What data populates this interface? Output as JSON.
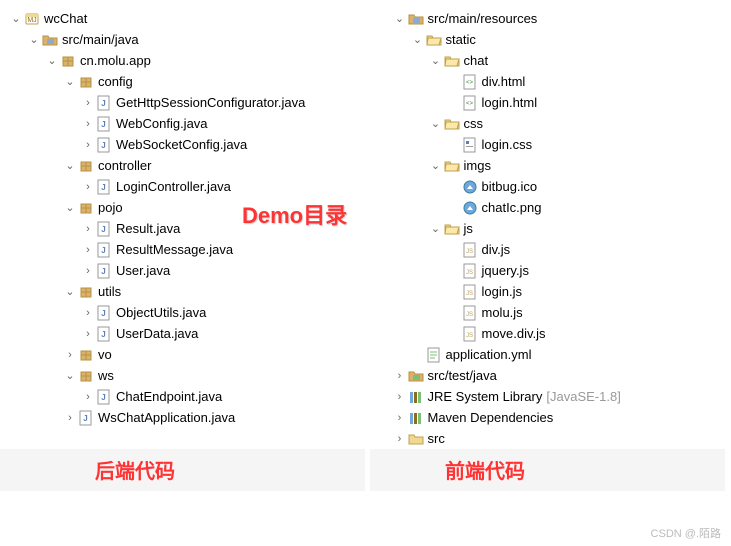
{
  "annotations": {
    "demo": "Demo目录",
    "backend": "后端代码",
    "frontend": "前端代码",
    "watermark": "CSDN @.陌路"
  },
  "left": [
    {
      "d": 0,
      "t": "v",
      "i": "project",
      "l": "wcChat"
    },
    {
      "d": 1,
      "t": "v",
      "i": "src-folder",
      "l": "src/main/java"
    },
    {
      "d": 2,
      "t": "v",
      "i": "package",
      "l": "cn.molu.app"
    },
    {
      "d": 3,
      "t": "v",
      "i": "package",
      "l": "config"
    },
    {
      "d": 4,
      "t": ">",
      "i": "java",
      "l": "GetHttpSessionConfigurator.java"
    },
    {
      "d": 4,
      "t": ">",
      "i": "java",
      "l": "WebConfig.java"
    },
    {
      "d": 4,
      "t": ">",
      "i": "java",
      "l": "WebSocketConfig.java"
    },
    {
      "d": 3,
      "t": "v",
      "i": "package",
      "l": "controller"
    },
    {
      "d": 4,
      "t": ">",
      "i": "java",
      "l": "LoginController.java"
    },
    {
      "d": 3,
      "t": "v",
      "i": "package",
      "l": "pojo"
    },
    {
      "d": 4,
      "t": ">",
      "i": "java",
      "l": "Result.java"
    },
    {
      "d": 4,
      "t": ">",
      "i": "java",
      "l": "ResultMessage.java"
    },
    {
      "d": 4,
      "t": ">",
      "i": "java",
      "l": "User.java"
    },
    {
      "d": 3,
      "t": "v",
      "i": "package",
      "l": "utils"
    },
    {
      "d": 4,
      "t": ">",
      "i": "java",
      "l": "ObjectUtils.java"
    },
    {
      "d": 4,
      "t": ">",
      "i": "java",
      "l": "UserData.java"
    },
    {
      "d": 3,
      "t": ">",
      "i": "package",
      "l": "vo"
    },
    {
      "d": 3,
      "t": "v",
      "i": "package",
      "l": "ws"
    },
    {
      "d": 4,
      "t": ">",
      "i": "java",
      "l": "ChatEndpoint.java"
    },
    {
      "d": 3,
      "t": ">",
      "i": "java",
      "l": "WsChatApplication.java"
    }
  ],
  "right": [
    {
      "d": 1,
      "t": "v",
      "i": "src-folder",
      "l": "src/main/resources"
    },
    {
      "d": 2,
      "t": "v",
      "i": "folder-open",
      "l": "static"
    },
    {
      "d": 3,
      "t": "v",
      "i": "folder-open",
      "l": "chat"
    },
    {
      "d": 4,
      "t": "",
      "i": "html",
      "l": "div.html"
    },
    {
      "d": 4,
      "t": "",
      "i": "html",
      "l": "login.html"
    },
    {
      "d": 3,
      "t": "v",
      "i": "folder-open",
      "l": "css"
    },
    {
      "d": 4,
      "t": "",
      "i": "css",
      "l": "login.css"
    },
    {
      "d": 3,
      "t": "v",
      "i": "folder-open",
      "l": "imgs"
    },
    {
      "d": 4,
      "t": "",
      "i": "image",
      "l": "bitbug.ico"
    },
    {
      "d": 4,
      "t": "",
      "i": "image",
      "l": "chatIc.png"
    },
    {
      "d": 3,
      "t": "v",
      "i": "folder-open",
      "l": "js"
    },
    {
      "d": 4,
      "t": "",
      "i": "js",
      "l": "div.js"
    },
    {
      "d": 4,
      "t": "",
      "i": "js",
      "l": "jquery.js"
    },
    {
      "d": 4,
      "t": "",
      "i": "js",
      "l": "login.js"
    },
    {
      "d": 4,
      "t": "",
      "i": "js",
      "l": "molu.js"
    },
    {
      "d": 4,
      "t": "",
      "i": "js",
      "l": "move.div.js"
    },
    {
      "d": 2,
      "t": "",
      "i": "yml",
      "l": "application.yml"
    },
    {
      "d": 1,
      "t": ">",
      "i": "src-folder-test",
      "l": "src/test/java"
    },
    {
      "d": 1,
      "t": ">",
      "i": "library",
      "l": "JRE System Library",
      "dec": "[JavaSE-1.8]"
    },
    {
      "d": 1,
      "t": ">",
      "i": "library",
      "l": "Maven Dependencies"
    },
    {
      "d": 1,
      "t": ">",
      "i": "folder",
      "l": "src"
    }
  ]
}
